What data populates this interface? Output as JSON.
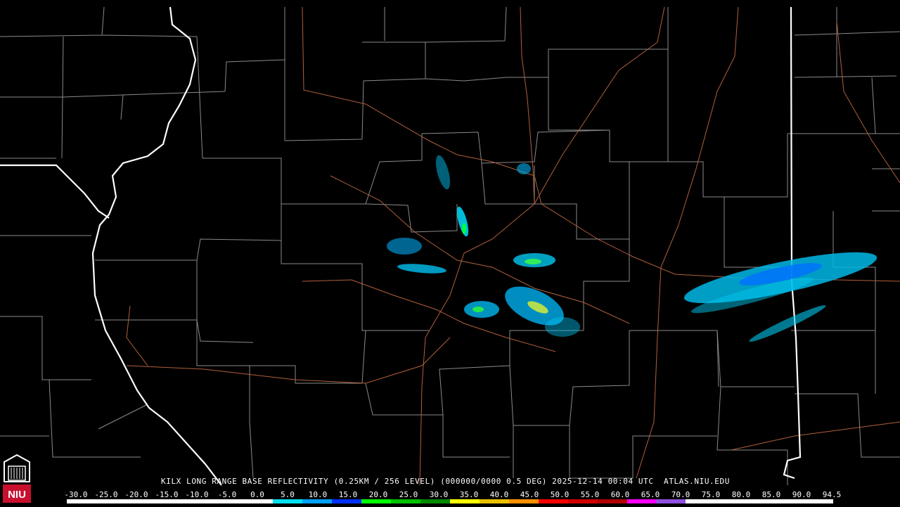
{
  "product_caption": "KILX LONG RANGE BASE REFLECTIVITY (0.25KM / 256 LEVEL) (000000/0000 0.5 DEG) 2025-12-14 00:04 UTC  ATLAS.NIU.EDU",
  "logo": {
    "text": "NIU",
    "color": "#c8102e"
  },
  "scale": {
    "labels": [
      "-30.0",
      "-25.0",
      "-20.0",
      "-15.0",
      "-10.0",
      "-5.0",
      "0.0",
      "5.0",
      "10.0",
      "15.0",
      "20.0",
      "25.0",
      "30.0",
      "35.0",
      "40.0",
      "45.0",
      "50.0",
      "55.0",
      "60.0",
      "65.0",
      "70.0",
      "75.0",
      "80.0",
      "85.0",
      "90.0",
      "94.5"
    ],
    "colors": [
      "#ffffff",
      "#ffffff",
      "#ffffff",
      "#ffffff",
      "#ffffff",
      "#ffffff",
      "#ffffff",
      "#00e0f0",
      "#00a0ff",
      "#0030ff",
      "#00ff00",
      "#00c000",
      "#008800",
      "#ffff00",
      "#e8c000",
      "#ff9000",
      "#ff0000",
      "#d00000",
      "#b00000",
      "#ff00ff",
      "#9050e0",
      "#ffffff",
      "#ffffff",
      "#ffffff",
      "#ffffff",
      "#ffffff"
    ]
  }
}
